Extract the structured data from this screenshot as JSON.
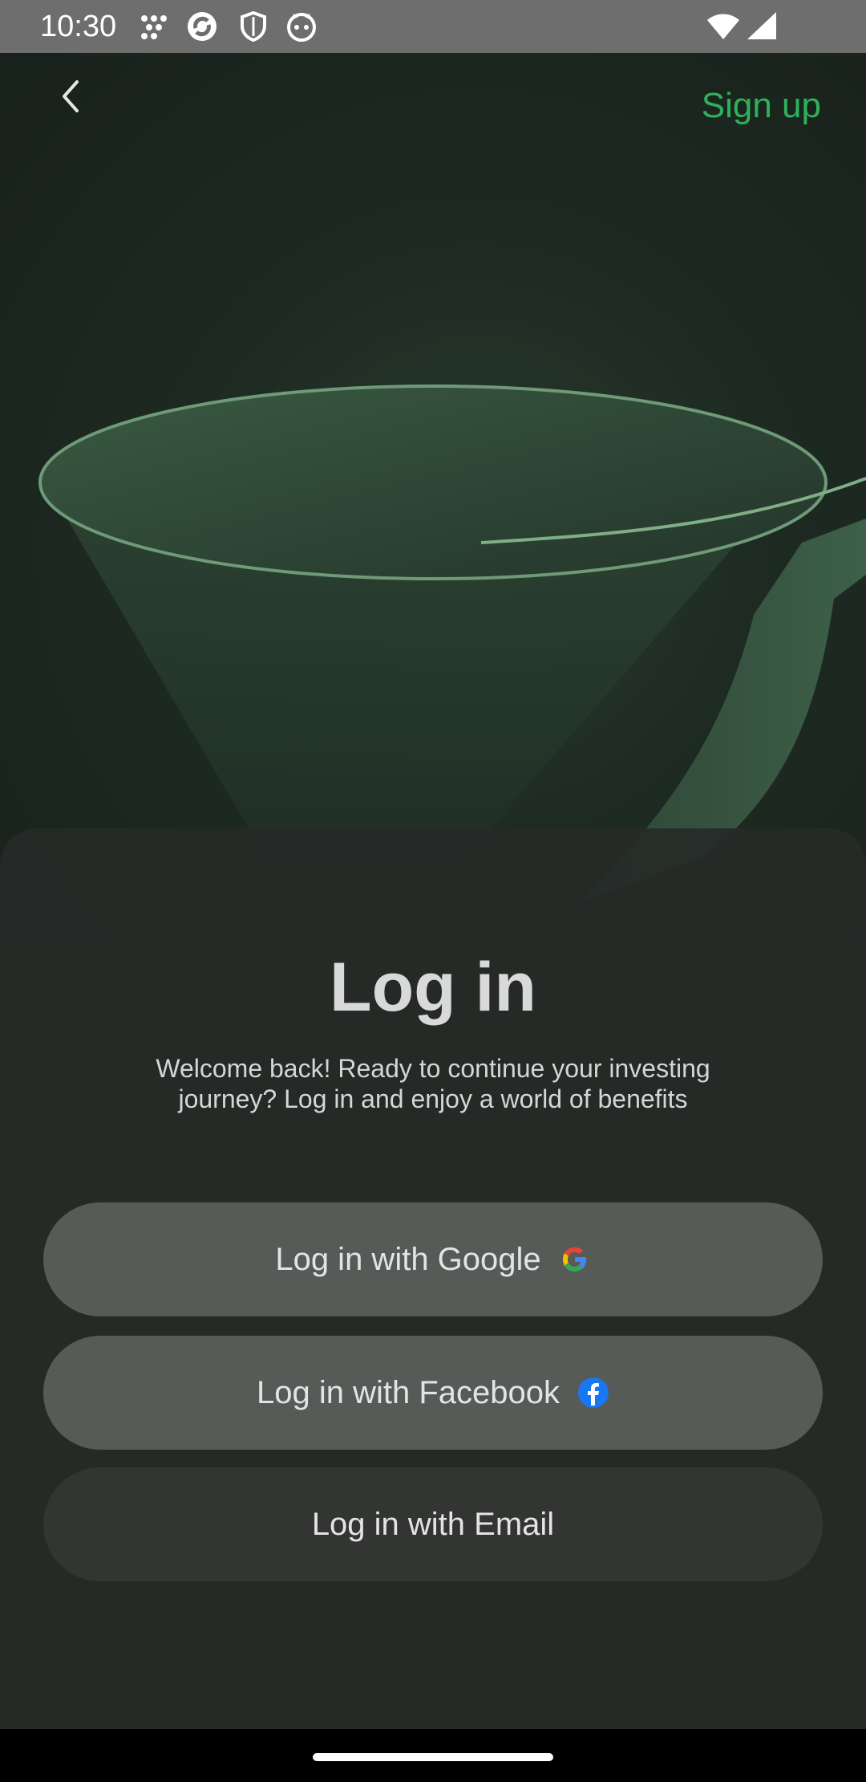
{
  "status_bar": {
    "time": "10:30",
    "left_icons": [
      "grid-dots-icon",
      "sync-icon",
      "shield-icon",
      "cat-face-icon"
    ],
    "right_icons": [
      "wifi-icon",
      "signal-icon"
    ]
  },
  "header": {
    "back_icon": "chevron-left-icon",
    "signup_label": "Sign up"
  },
  "sheet": {
    "title": "Log in",
    "subtitle": "Welcome back! Ready to continue your investing journey? Log in and enjoy a world of benefits"
  },
  "buttons": {
    "google_label": "Log in with Google",
    "facebook_label": "Log in with Facebook",
    "email_label": "Log in with Email"
  },
  "colors": {
    "accent_green": "#2fb05a",
    "sheet_bg": "#262a28",
    "button_bg": "#565b58",
    "email_button_bg": "#333533",
    "facebook_blue": "#1877f2"
  }
}
